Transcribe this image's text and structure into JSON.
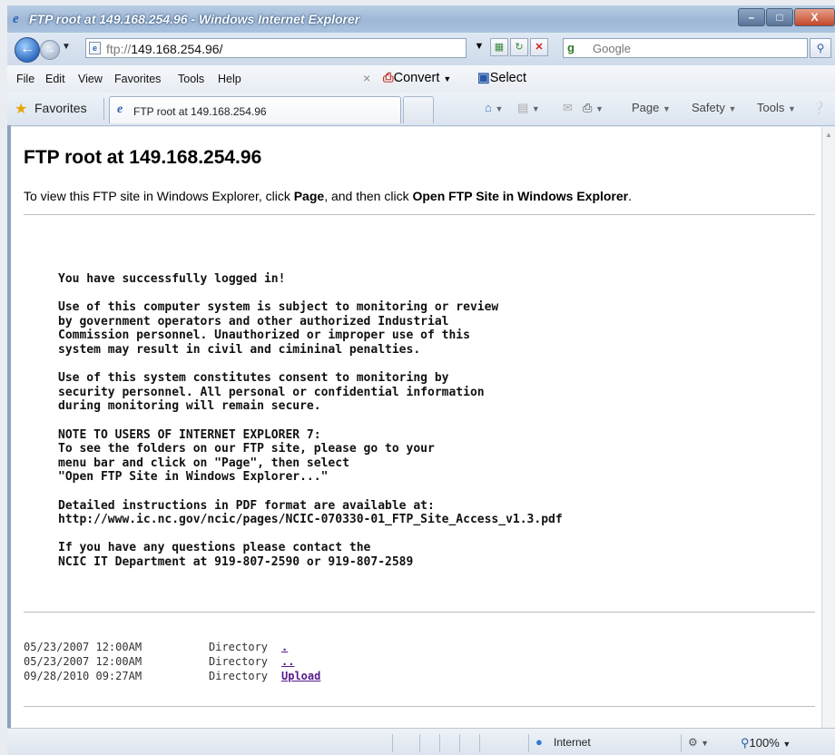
{
  "window": {
    "title": "FTP root at 149.168.254.96 - Windows Internet Explorer",
    "minimize": "–",
    "maximize": "□",
    "close": "X"
  },
  "address": {
    "url_prefix": "ftp://",
    "url_host": "149.168.254.96/",
    "search_placeholder": "Google",
    "search_engine_glyph": "g"
  },
  "menu": {
    "items": [
      "File",
      "Edit",
      "View",
      "Favorites",
      "Tools",
      "Help"
    ],
    "close_glyph": "×",
    "convert_label": "Convert",
    "select_label": "Select"
  },
  "favorites": {
    "label": "Favorites",
    "tab_title": "FTP root at 149.168.254.96",
    "commands": {
      "page": "Page",
      "safety": "Safety",
      "tools": "Tools"
    }
  },
  "page": {
    "heading": "FTP root at 149.168.254.96",
    "instr_before": "To view this FTP site in Windows Explorer, click ",
    "instr_page": "Page",
    "instr_middle": ", and then click ",
    "instr_open": "Open FTP Site in Windows Explorer",
    "instr_end": ".",
    "message": "You have successfully logged in!\n\nUse of this computer system is subject to monitoring or review\nby government operators and other authorized Industrial\nCommission personnel. Unauthorized or improper use of this\nsystem may result in civil and cimininal penalties.\n\nUse of this system constitutes consent to monitoring by\nsecurity personnel. All personal or confidential information\nduring monitoring will remain secure.\n\nNOTE TO USERS OF INTERNET EXPLORER 7:\nTo see the folders on our FTP site, please go to your\nmenu bar and click on \"Page\", then select\n\"Open FTP Site in Windows Explorer...\"\n\nDetailed instructions in PDF format are available at:\nhttp://www.ic.nc.gov/ncic/pages/NCIC-070330-01_FTP_Site_Access_v1.3.pdf\n\nIf you have any questions please contact the\nNCIC IT Department at 919-807-2590 or 919-807-2589",
    "listing": [
      {
        "date": "05/23/2007 12:00AM",
        "type": "Directory",
        "name": "."
      },
      {
        "date": "05/23/2007 12:00AM",
        "type": "Directory",
        "name": ".."
      },
      {
        "date": "09/28/2010 09:27AM",
        "type": "Directory",
        "name": "Upload"
      }
    ]
  },
  "status": {
    "zone": "Internet",
    "zoom": "100%"
  }
}
